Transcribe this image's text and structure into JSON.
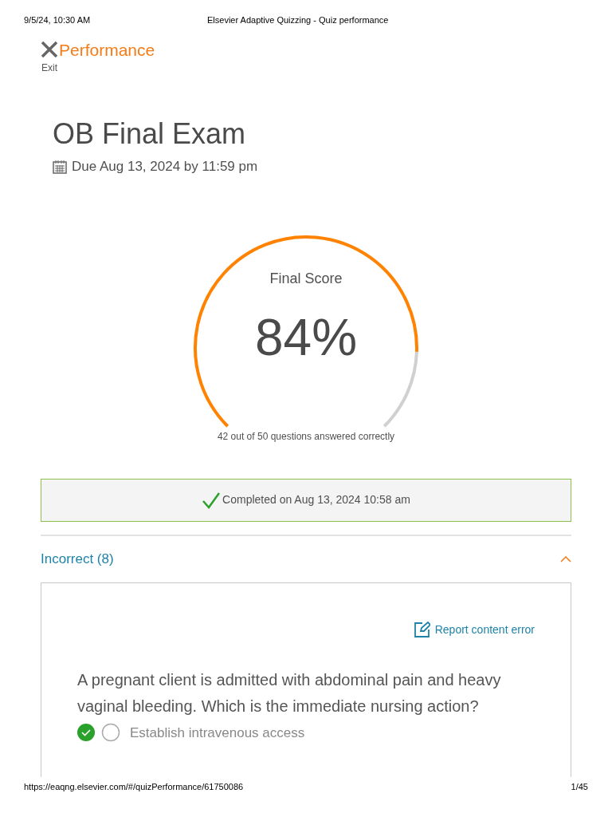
{
  "print_header": {
    "date": "9/5/24, 10:30 AM",
    "title": "Elsevier Adaptive Quizzing - Quiz performance"
  },
  "header": {
    "title": "Performance",
    "exit_label": "Exit"
  },
  "quiz": {
    "title": "OB Final Exam",
    "due": "Due Aug 13, 2024 by 11:59 pm"
  },
  "score": {
    "label": "Final Score",
    "value": "84%",
    "summary": "42 out of 50 questions answered correctly"
  },
  "completion": {
    "text": "Completed on Aug 13, 2024 10:58 am"
  },
  "section": {
    "title": "Incorrect (8)",
    "expanded": true
  },
  "question": {
    "report_link": "Report content error",
    "text": "A pregnant client is admitted with abdominal pain and heavy vaginal bleeding. Which is the immediate nursing action?",
    "answers": [
      {
        "text": "Establish intravenous access",
        "correct": true,
        "selected": false
      }
    ]
  },
  "print_footer": {
    "url": "https://eaqng.elsevier.com/#/quizPerformance/61750086",
    "page": "1/45"
  }
}
